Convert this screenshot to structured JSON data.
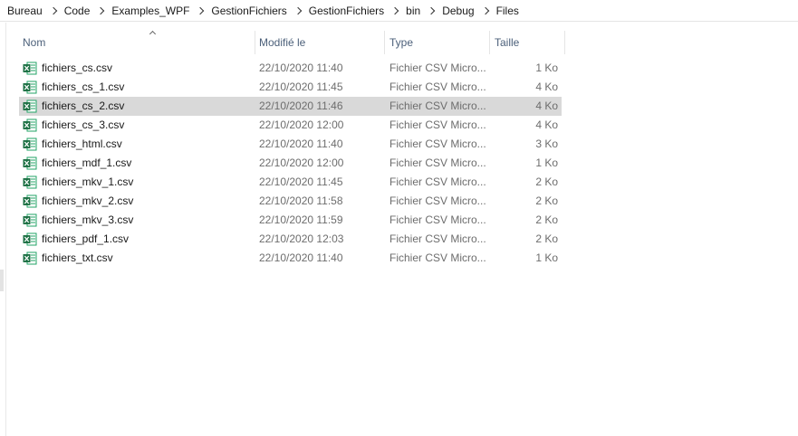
{
  "breadcrumb": {
    "items": [
      "Bureau",
      "Code",
      "Examples_WPF",
      "GestionFichiers",
      "GestionFichiers",
      "bin",
      "Debug",
      "Files"
    ]
  },
  "columns": {
    "name": "Nom",
    "modified": "Modifié le",
    "type": "Type",
    "size": "Taille"
  },
  "files": [
    {
      "name": "fichiers_cs.csv",
      "modified": "22/10/2020 11:40",
      "type": "Fichier CSV Micro...",
      "size": "1 Ko",
      "selected": false
    },
    {
      "name": "fichiers_cs_1.csv",
      "modified": "22/10/2020 11:45",
      "type": "Fichier CSV Micro...",
      "size": "4 Ko",
      "selected": false
    },
    {
      "name": "fichiers_cs_2.csv",
      "modified": "22/10/2020 11:46",
      "type": "Fichier CSV Micro...",
      "size": "4 Ko",
      "selected": true
    },
    {
      "name": "fichiers_cs_3.csv",
      "modified": "22/10/2020 12:00",
      "type": "Fichier CSV Micro...",
      "size": "4 Ko",
      "selected": false
    },
    {
      "name": "fichiers_html.csv",
      "modified": "22/10/2020 11:40",
      "type": "Fichier CSV Micro...",
      "size": "3 Ko",
      "selected": false
    },
    {
      "name": "fichiers_mdf_1.csv",
      "modified": "22/10/2020 12:00",
      "type": "Fichier CSV Micro...",
      "size": "1 Ko",
      "selected": false
    },
    {
      "name": "fichiers_mkv_1.csv",
      "modified": "22/10/2020 11:45",
      "type": "Fichier CSV Micro...",
      "size": "2 Ko",
      "selected": false
    },
    {
      "name": "fichiers_mkv_2.csv",
      "modified": "22/10/2020 11:58",
      "type": "Fichier CSV Micro...",
      "size": "2 Ko",
      "selected": false
    },
    {
      "name": "fichiers_mkv_3.csv",
      "modified": "22/10/2020 11:59",
      "type": "Fichier CSV Micro...",
      "size": "2 Ko",
      "selected": false
    },
    {
      "name": "fichiers_pdf_1.csv",
      "modified": "22/10/2020 12:03",
      "type": "Fichier CSV Micro...",
      "size": "2 Ko",
      "selected": false
    },
    {
      "name": "fichiers_txt.csv",
      "modified": "22/10/2020 11:40",
      "type": "Fichier CSV Micro...",
      "size": "1 Ko",
      "selected": false
    }
  ],
  "icons": {
    "file_icon": "excel-csv-file-icon",
    "sort_icon": "sort-ascending-icon",
    "separator_icon": "chevron-right-icon"
  },
  "colors": {
    "selected_row": "#d9d9d9",
    "header_text": "#4c607a",
    "excel_green": "#1e7145"
  }
}
